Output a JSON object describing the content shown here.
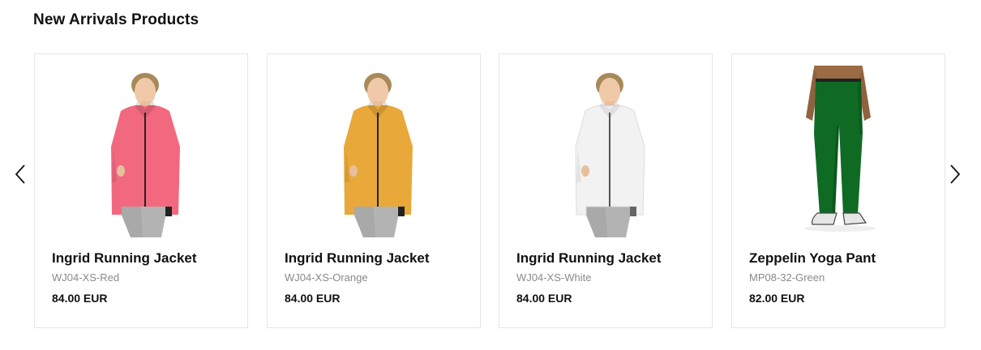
{
  "section": {
    "title": "New Arrivals Products"
  },
  "carousel": {
    "prev_icon": "chevron-left-icon",
    "next_icon": "chevron-right-icon"
  },
  "products": [
    {
      "name": "Ingrid Running Jacket",
      "sku": "WJ04-XS-Red",
      "price": "84.00 EUR",
      "color": "#f2697f",
      "type": "jacket"
    },
    {
      "name": "Ingrid Running Jacket",
      "sku": "WJ04-XS-Orange",
      "price": "84.00 EUR",
      "color": "#e9a83a",
      "type": "jacket"
    },
    {
      "name": "Ingrid Running Jacket",
      "sku": "WJ04-XS-White",
      "price": "84.00 EUR",
      "color": "#f2f2f2",
      "type": "jacket"
    },
    {
      "name": "Zeppelin Yoga Pant",
      "sku": "MP08-32-Green",
      "price": "82.00 EUR",
      "color": "#0f6b23",
      "type": "pant"
    }
  ]
}
